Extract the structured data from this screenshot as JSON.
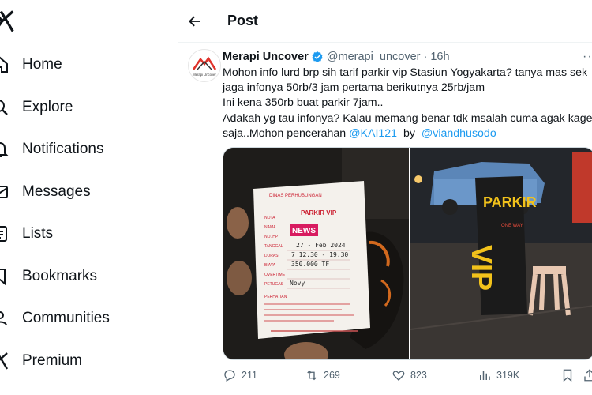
{
  "sidebar": {
    "items": [
      {
        "label": "Home",
        "icon": "home-icon"
      },
      {
        "label": "Explore",
        "icon": "search-icon"
      },
      {
        "label": "Notifications",
        "icon": "bell-icon"
      },
      {
        "label": "Messages",
        "icon": "envelope-icon"
      },
      {
        "label": "Lists",
        "icon": "list-icon"
      },
      {
        "label": "Bookmarks",
        "icon": "bookmark-icon"
      },
      {
        "label": "Communities",
        "icon": "people-icon"
      },
      {
        "label": "Premium",
        "icon": "x-logo-icon"
      }
    ]
  },
  "header": {
    "title": "Post"
  },
  "tweet": {
    "author": "Merapi Uncover",
    "handle": "@merapi_uncover",
    "separator": "·",
    "time": "16h",
    "lines": [
      "Mohon info lurd brp sih tarif parkir vip Stasiun Yogyakarta? tanya mas sek",
      "jaga infonya 50rb/3 jam pertama berikutnya 25rb/jam",
      "Ini kena  350rb buat parkir 7jam..",
      "Adakah yg tau infonya? Kalau memang benar tdk msalah cuma agak kaget",
      "saja..Mohon pencerahan "
    ],
    "mention1": "@KAI121",
    "by_text": "  by  ",
    "mention2": "@viandhusodo",
    "avatar_text": "Merapi Uncover"
  },
  "photos": {
    "receipt": {
      "heading": "PARKIR VIP",
      "badge": "NEWS",
      "date": "27 - Feb 2024",
      "time": "7    12.30 - 19.30",
      "amount": "350.000  TF",
      "officer": "Novy",
      "labels": [
        "NOTA",
        "NAMA",
        "NO. HP",
        "TANGGAL",
        "DURASI",
        "BIAYA",
        "OVERTIME",
        "PETUGAS"
      ]
    },
    "sign": {
      "top": "PARKIR",
      "bottom": "VIP"
    }
  },
  "actions": {
    "replies": "211",
    "reposts": "269",
    "likes": "823",
    "views": "319K"
  },
  "colors": {
    "accent": "#1d9bf0",
    "text": "#0f1419",
    "muted": "#536471"
  }
}
